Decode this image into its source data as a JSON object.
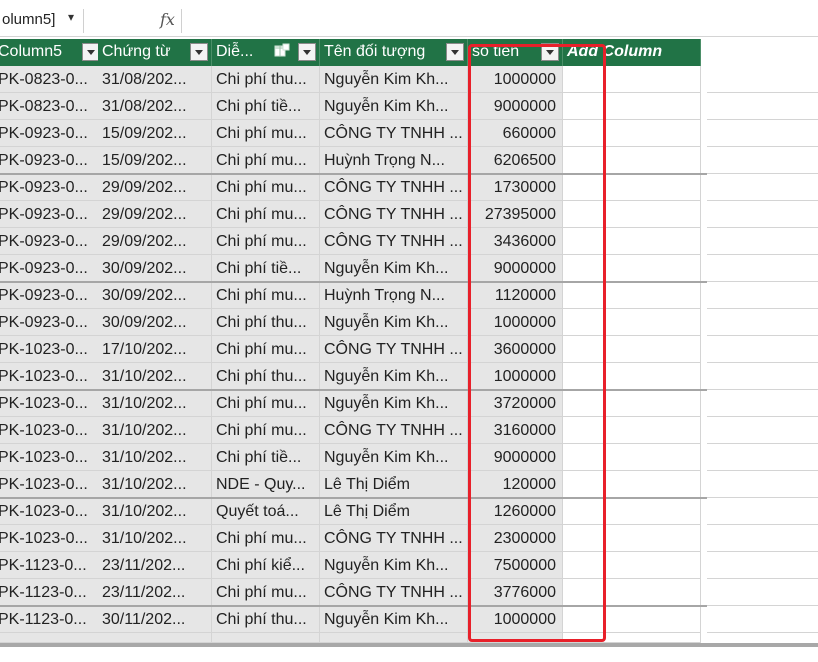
{
  "formula_bar": {
    "name_box": "olumn5]",
    "fx_symbol": "fx",
    "formula": ""
  },
  "colors": {
    "header_bg": "#217346",
    "header_text": "#ffffff",
    "cell_bg": "#e6e6e6",
    "highlight": "#e8202a"
  },
  "columns": [
    {
      "label": "Column5",
      "filter": true
    },
    {
      "label": "Chứng từ",
      "filter": true
    },
    {
      "label": "Diễ...",
      "filter": true,
      "icon": "table-icon"
    },
    {
      "label": "Tên đối tượng",
      "filter": true
    },
    {
      "label": "so tien",
      "filter": true
    },
    {
      "label": "Add Column",
      "filter": false
    }
  ],
  "rows": [
    [
      "PK-0823-0...",
      "31/08/202...",
      "Chi phí thu...",
      "Nguyễn Kim Kh...",
      "1000000"
    ],
    [
      "PK-0823-0...",
      "31/08/202...",
      "Chi phí tiề...",
      "Nguyễn Kim Kh...",
      "9000000"
    ],
    [
      "PK-0923-0...",
      "15/09/202...",
      "Chi phí mu...",
      "CÔNG TY TNHH ...",
      "660000"
    ],
    [
      "PK-0923-0...",
      "15/09/202...",
      "Chi phí mu...",
      "Huỳnh Trọng N...",
      "6206500"
    ],
    [
      "PK-0923-0...",
      "29/09/202...",
      "Chi phí mu...",
      "CÔNG TY TNHH ...",
      "1730000"
    ],
    [
      "PK-0923-0...",
      "29/09/202...",
      "Chi phí mu...",
      "CÔNG TY TNHH ...",
      "27395000"
    ],
    [
      "PK-0923-0...",
      "29/09/202...",
      "Chi phí mu...",
      "CÔNG TY TNHH ...",
      "3436000"
    ],
    [
      "PK-0923-0...",
      "30/09/202...",
      "Chi phí tiề...",
      "Nguyễn Kim Kh...",
      "9000000"
    ],
    [
      "PK-0923-0...",
      "30/09/202...",
      "Chi phí mu...",
      "Huỳnh Trọng N...",
      "1120000"
    ],
    [
      "PK-0923-0...",
      "30/09/202...",
      "Chi phí thu...",
      "Nguyễn Kim Kh...",
      "1000000"
    ],
    [
      "PK-1023-0...",
      "17/10/202...",
      "Chi phí mu...",
      "CÔNG TY TNHH ...",
      "3600000"
    ],
    [
      "PK-1023-0...",
      "31/10/202...",
      "Chi phí thu...",
      "Nguyễn Kim Kh...",
      "1000000"
    ],
    [
      "PK-1023-0...",
      "31/10/202...",
      "Chi phí mu...",
      "Nguyễn Kim Kh...",
      "3720000"
    ],
    [
      "PK-1023-0...",
      "31/10/202...",
      "Chi phí mu...",
      "CÔNG TY TNHH ...",
      "3160000"
    ],
    [
      "PK-1023-0...",
      "31/10/202...",
      "Chi phí tiề...",
      "Nguyễn Kim Kh...",
      "9000000"
    ],
    [
      "PK-1023-0...",
      "31/10/202...",
      "NDE - Quy...",
      "Lê Thị Diểm",
      "120000"
    ],
    [
      "PK-1023-0...",
      "31/10/202...",
      "Quyết toá...",
      "Lê Thị Diểm",
      "1260000"
    ],
    [
      "PK-1023-0...",
      "31/10/202...",
      "Chi phí mu...",
      "CÔNG TY TNHH ...",
      "2300000"
    ],
    [
      "PK-1123-0...",
      "23/11/202...",
      "Chi phí kiể...",
      "Nguyễn Kim Kh...",
      "7500000"
    ],
    [
      "PK-1123-0...",
      "23/11/202...",
      "Chi phí mu...",
      "CÔNG TY TNHH ...",
      "3776000"
    ],
    [
      "PK-1123-0...",
      "30/11/202...",
      "Chi phí thu...",
      "Nguyễn Kim Kh...",
      "1000000"
    ]
  ]
}
